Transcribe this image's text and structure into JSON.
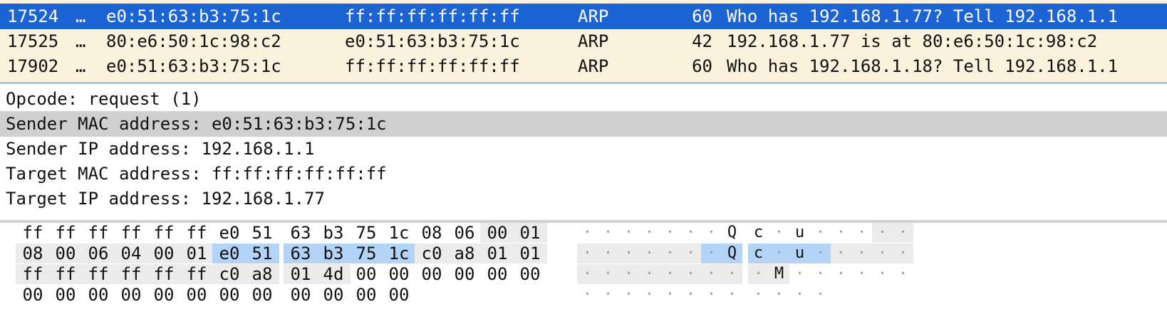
{
  "packet_list": {
    "rows": [
      {
        "no": "17524",
        "more": "…",
        "source": "e0:51:63:b3:75:1c",
        "destination": "ff:ff:ff:ff:ff:ff",
        "protocol": "ARP",
        "length": "60",
        "info": "Who has 192.168.1.77? Tell 192.168.1.1",
        "selected": true
      },
      {
        "no": "17525",
        "more": "…",
        "source": "80:e6:50:1c:98:c2",
        "destination": "e0:51:63:b3:75:1c",
        "protocol": "ARP",
        "length": "42",
        "info": "192.168.1.77 is at 80:e6:50:1c:98:c2",
        "selected": false
      },
      {
        "no": "17902",
        "more": "…",
        "source": "e0:51:63:b3:75:1c",
        "destination": "ff:ff:ff:ff:ff:ff",
        "protocol": "ARP",
        "length": "60",
        "info": "Who has 192.168.1.18? Tell 192.168.1.1",
        "selected": false
      }
    ]
  },
  "packet_details": {
    "rows": [
      {
        "text": "Opcode: request (1)",
        "highlighted": false
      },
      {
        "text": "Sender MAC address: e0:51:63:b3:75:1c",
        "highlighted": true
      },
      {
        "text": "Sender IP address: 192.168.1.1",
        "highlighted": false
      },
      {
        "text": "Target MAC address: ff:ff:ff:ff:ff:ff",
        "highlighted": false
      },
      {
        "text": "Target IP address: 192.168.1.77",
        "highlighted": false
      }
    ]
  },
  "packet_bytes": {
    "rows": [
      {
        "hex": [
          "ff",
          "ff",
          "ff",
          "ff",
          "ff",
          "ff",
          "e0",
          "51",
          "63",
          "b3",
          "75",
          "1c",
          "08",
          "06",
          "00",
          "01"
        ],
        "ascii": [
          "·",
          "·",
          "·",
          "·",
          "·",
          "·",
          "·",
          "Q",
          "c",
          "·",
          "u",
          "·",
          "·",
          "·",
          "·",
          "·"
        ]
      },
      {
        "hex": [
          "08",
          "00",
          "06",
          "04",
          "00",
          "01",
          "e0",
          "51",
          "63",
          "b3",
          "75",
          "1c",
          "c0",
          "a8",
          "01",
          "01"
        ],
        "ascii": [
          "·",
          "·",
          "·",
          "·",
          "·",
          "·",
          "·",
          "Q",
          "c",
          "·",
          "u",
          "·",
          "·",
          "·",
          "·",
          "·"
        ]
      },
      {
        "hex": [
          "ff",
          "ff",
          "ff",
          "ff",
          "ff",
          "ff",
          "c0",
          "a8",
          "01",
          "4d",
          "00",
          "00",
          "00",
          "00",
          "00",
          "00"
        ],
        "ascii": [
          "·",
          "·",
          "·",
          "·",
          "·",
          "·",
          "·",
          "·",
          "·",
          "M",
          "·",
          "·",
          "·",
          "·",
          "·",
          "·"
        ]
      },
      {
        "hex": [
          "00",
          "00",
          "00",
          "00",
          "00",
          "00",
          "00",
          "00",
          "00",
          "00",
          "00",
          "00"
        ],
        "ascii": [
          "·",
          "·",
          "·",
          "·",
          "·",
          "·",
          "·",
          "·",
          "·",
          "·",
          "·",
          "·"
        ]
      }
    ],
    "selected_range": {
      "start": 22,
      "end": 27
    },
    "field_range": {
      "start": 14,
      "end": 41
    }
  }
}
